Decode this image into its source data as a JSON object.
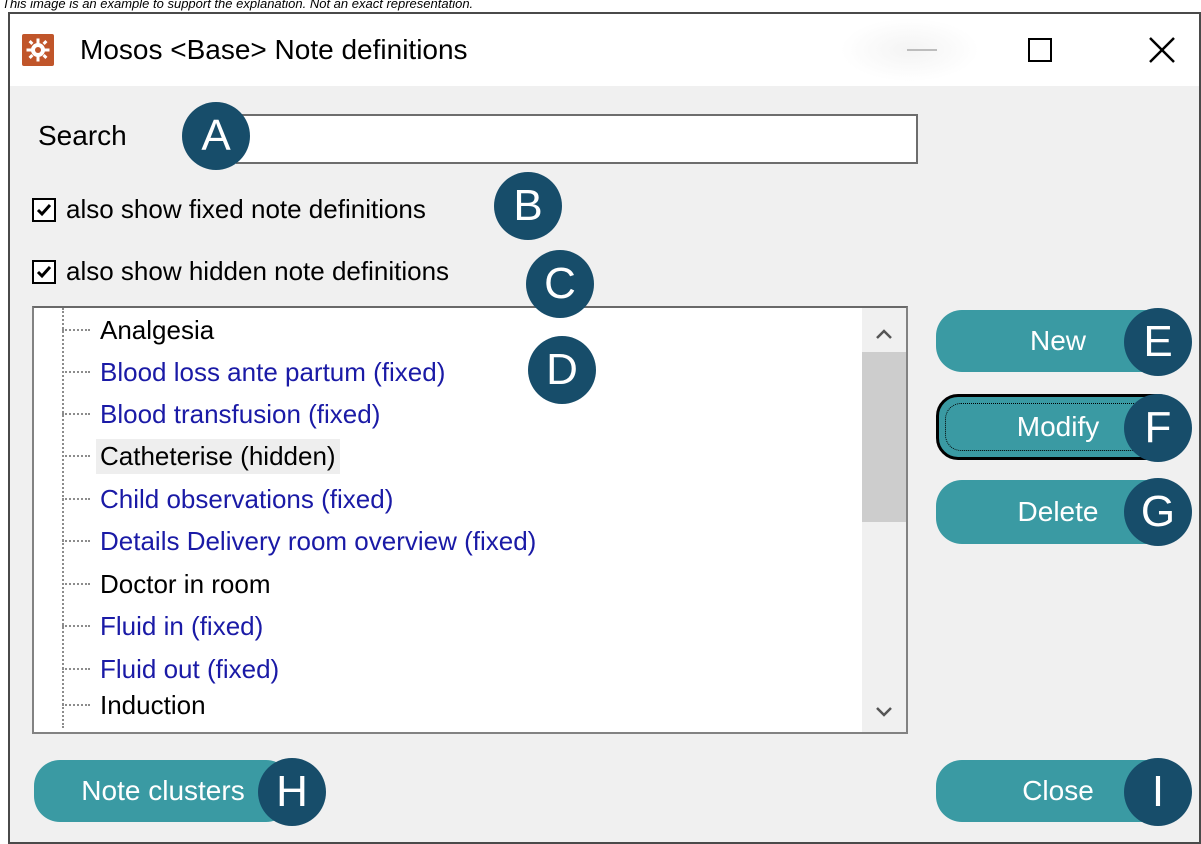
{
  "disclaimer": "This image is an example to support the explanation. Not an exact representation.",
  "window": {
    "title": "Mosos <Base> Note definitions",
    "icon": "settings-gear-icon"
  },
  "search": {
    "label": "Search",
    "value": "",
    "placeholder": ""
  },
  "options": {
    "fixed": {
      "label": "also show fixed note definitions",
      "checked": true
    },
    "hidden": {
      "label": "also show hidden note definitions",
      "checked": true
    }
  },
  "tree": {
    "items": [
      {
        "label": "Analgesia",
        "kind": "normal"
      },
      {
        "label": "Blood loss ante partum (fixed)",
        "kind": "fixed"
      },
      {
        "label": "Blood transfusion (fixed)",
        "kind": "fixed"
      },
      {
        "label": "Catheterise (hidden)",
        "kind": "selected"
      },
      {
        "label": "Child observations (fixed)",
        "kind": "fixed"
      },
      {
        "label": "Details Delivery room overview (fixed)",
        "kind": "fixed"
      },
      {
        "label": "Doctor in room",
        "kind": "normal"
      },
      {
        "label": "Fluid in (fixed)",
        "kind": "fixed"
      },
      {
        "label": "Fluid out (fixed)",
        "kind": "fixed"
      },
      {
        "label": "Induction",
        "kind": "normal"
      }
    ]
  },
  "buttons": {
    "new": "New",
    "modify": "Modify",
    "delete": "Delete",
    "note_clusters": "Note clusters",
    "close": "Close"
  },
  "markers": {
    "a": "A",
    "b": "B",
    "c": "C",
    "d": "D",
    "e": "E",
    "f": "F",
    "g": "G",
    "h": "H",
    "i": "I"
  },
  "colors": {
    "button_teal": "#3a9aa3",
    "marker_navy": "#174d6a",
    "fixed_text": "#1a1aa6"
  }
}
